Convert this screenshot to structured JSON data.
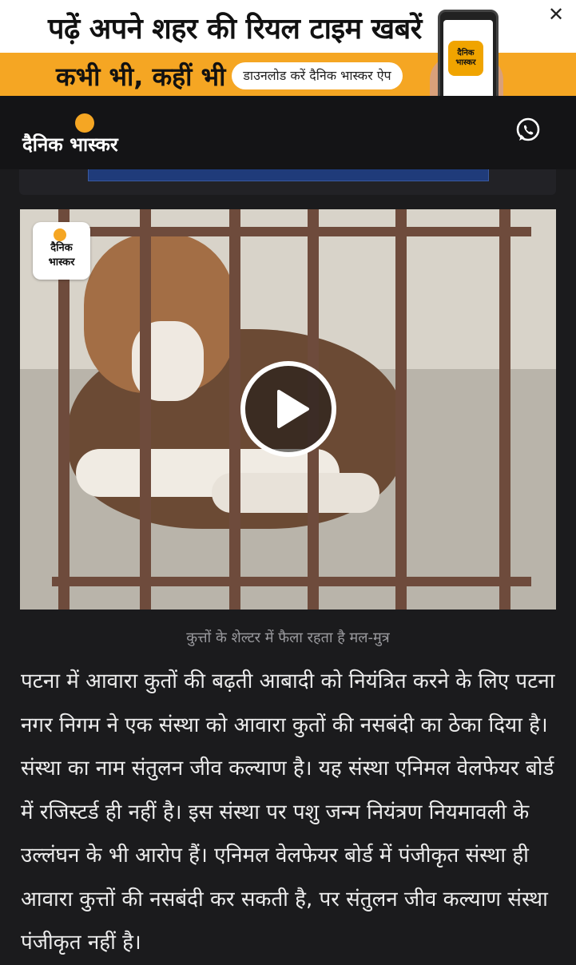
{
  "banner": {
    "headline": "पढ़ें अपने शहर की रियल टाइम खबरें",
    "subline": "कभी भी, कहीं भी",
    "download_label": "डाउनलोड करें दैनिक भास्कर ऐप",
    "app_tile_text": "दैनिक भास्कर",
    "close_glyph": "✕",
    "accent_color": "#f5a623"
  },
  "header": {
    "logo_text": "दैनिक भास्कर",
    "share_icon": "whatsapp-icon"
  },
  "video": {
    "watermark_text": "दैनिक भास्कर",
    "play_icon": "play-icon",
    "caption": "कुत्तों के शेल्टर में फैला रहता है मल-मुत्र"
  },
  "article": {
    "paragraph": "पटना में आवारा कुतों की बढ़ती आबादी को नियंत्रित करने के लिए पटना नगर निगम ने एक संस्था को आवारा कुतों की नसबंदी का ठेका दिया है। संस्था का नाम संतुलन जीव कल्याण है। यह संस्था एनिमल वेलफेयर बोर्ड में रजिस्टर्ड ही नहीं है। इस संस्था पर पशु जन्म नियंत्रण नियमावली के उल्लंघन के भी आरोप हैं। एनिमल वेलफेयर बोर्ड में पंजीकृत संस्था ही आवारा कुत्तों की नसबंदी कर सकती है, पर संतुलन जीव कल्याण संस्था पंजीकृत नहीं है।"
  }
}
